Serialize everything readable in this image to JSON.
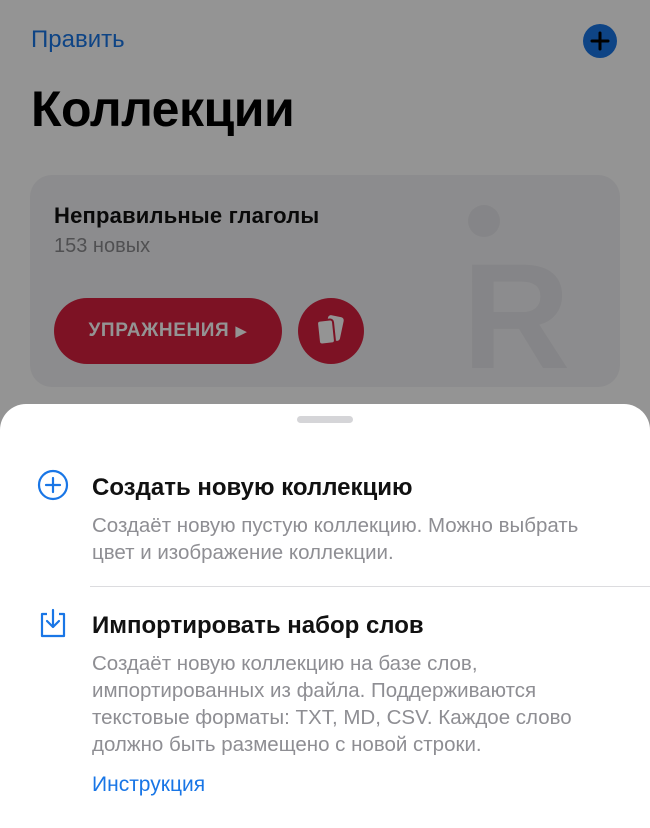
{
  "header": {
    "edit_label": "Править",
    "add_icon": "plus-circle-icon",
    "title": "Коллекции"
  },
  "collection": {
    "title": "Неправильные глаголы",
    "subtitle": "153 новых",
    "logo_letter": "R",
    "exercise_label": "УПРАЖНЕНИЯ",
    "exercise_icon": "play-icon",
    "cards_icon": "cards-icon",
    "accent_color": "#d81f3f"
  },
  "sheet": {
    "create": {
      "icon": "plus-circle-icon",
      "title": "Создать новую коллекцию",
      "description": "Создаёт новую пустую коллекцию. Можно выбрать цвет и изображение коллекции."
    },
    "import": {
      "icon": "download-tray-icon",
      "title": "Импортировать набор слов",
      "description": "Создаёт новую коллекцию на базе слов, импортированных из файла. Поддерживаются текстовые форматы: TXT, MD, CSV. Каждое слово должно быть размещено с новой строки.",
      "link_label": "Инструкция"
    }
  },
  "colors": {
    "accent_blue": "#1976e6",
    "secondary_text": "#8e8e93"
  }
}
